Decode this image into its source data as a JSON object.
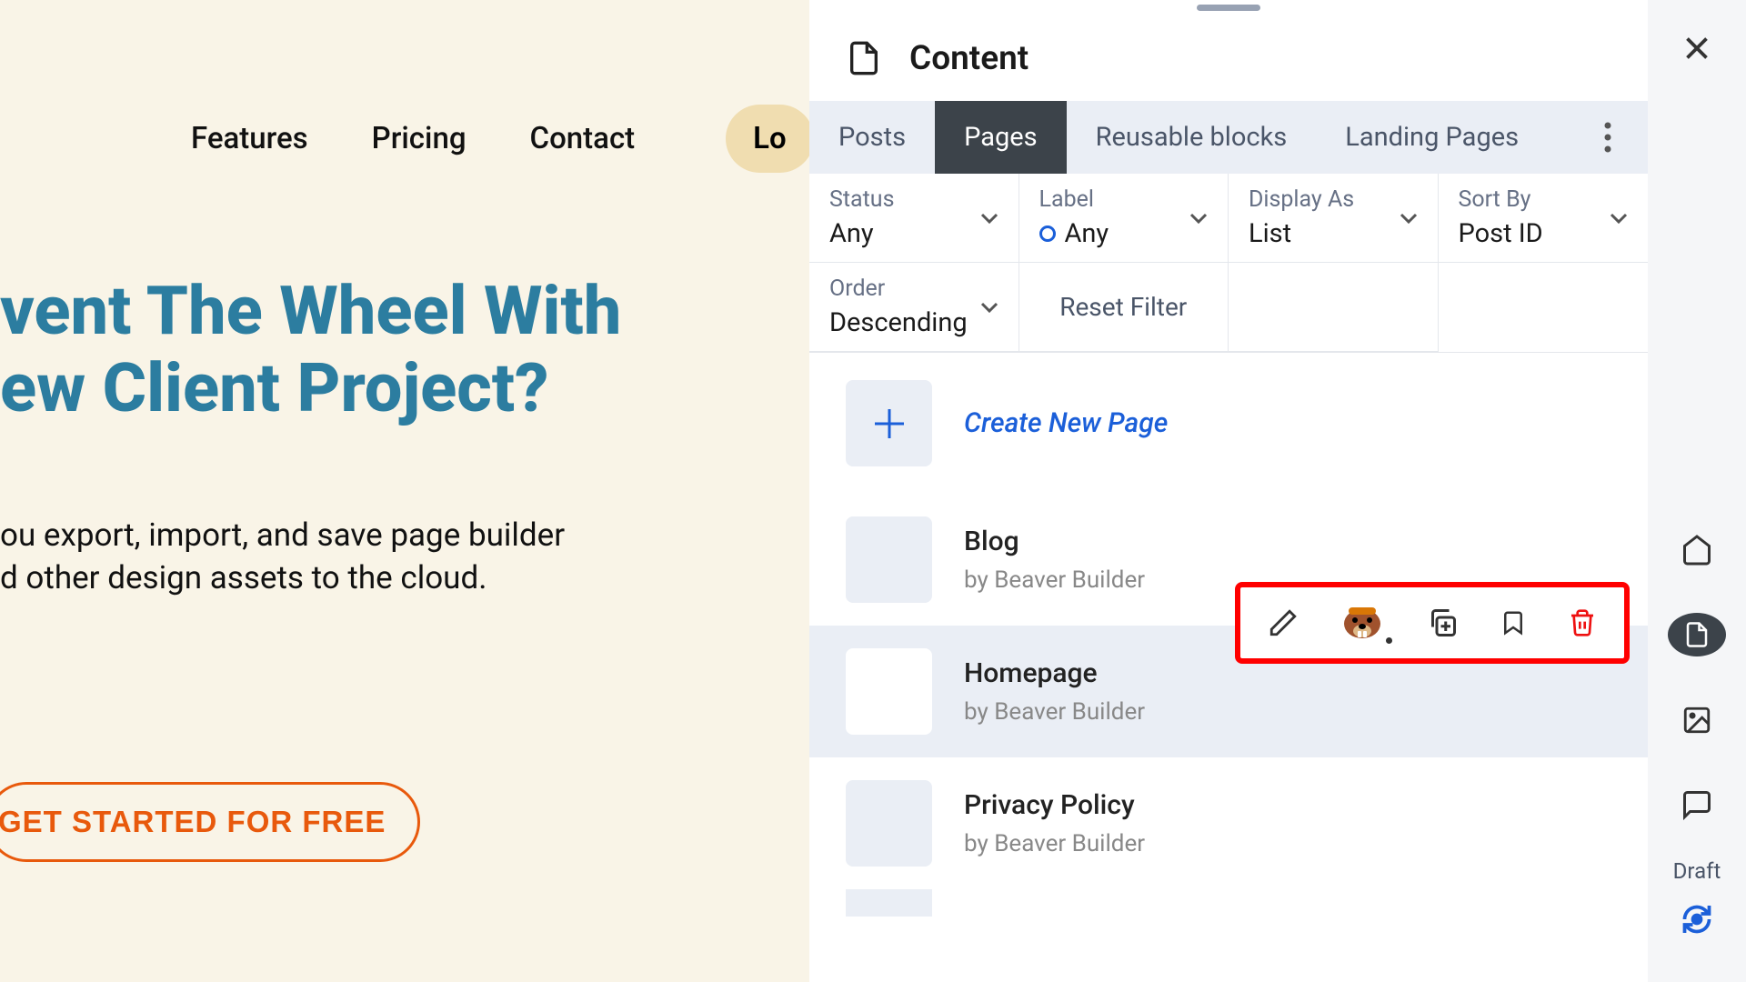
{
  "background": {
    "nav": {
      "features": "Features",
      "pricing": "Pricing",
      "contact": "Contact",
      "login": "Lo"
    },
    "headline_line1": "vent The Wheel With",
    "headline_line2": "ew Client Project?",
    "sub_line1": "ou export, import, and save page builder",
    "sub_line2": "d other design assets to the cloud.",
    "cta": "GET STARTED FOR FREE"
  },
  "panel": {
    "title": "Content",
    "tabs": {
      "posts": "Posts",
      "pages": "Pages",
      "reusable": "Reusable blocks",
      "landing": "Landing Pages"
    },
    "filters": {
      "status": {
        "label": "Status",
        "value": "Any"
      },
      "label": {
        "label": "Label",
        "value": "Any"
      },
      "display": {
        "label": "Display As",
        "value": "List"
      },
      "sort": {
        "label": "Sort By",
        "value": "Post ID"
      },
      "order": {
        "label": "Order",
        "value": "Descending"
      },
      "reset": "Reset Filter"
    },
    "create": "Create New Page",
    "pages": [
      {
        "title": "Blog",
        "author": "by Beaver Builder"
      },
      {
        "title": "Homepage",
        "author": "by Beaver Builder"
      },
      {
        "title": "Privacy Policy",
        "author": "by Beaver Builder"
      }
    ]
  },
  "sidebar": {
    "draft": "Draft"
  }
}
